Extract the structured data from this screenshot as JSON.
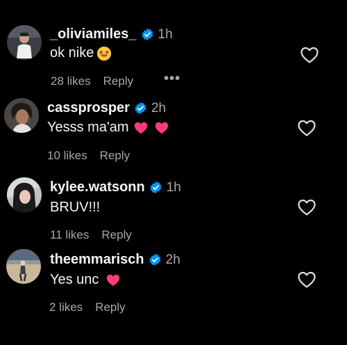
{
  "comments": [
    {
      "username": "_oliviamiles_",
      "time": "1h",
      "text": "ok nike",
      "emoji": "grinning-squinting-face",
      "likes": "28 likes",
      "reply": "Reply",
      "more": "•••"
    },
    {
      "username": "cassprosper",
      "time": "2h",
      "text": "Yesss ma'am",
      "emoji": "two-pink-hearts",
      "likes": "10 likes",
      "reply": "Reply"
    },
    {
      "username": "kylee.watsonn",
      "time": "1h",
      "text": "BRUV!!!",
      "likes": "11 likes",
      "reply": "Reply"
    },
    {
      "username": "theemmarisch",
      "time": "2h",
      "text": "Yes unc",
      "emoji": "pink-heart",
      "likes": "2 likes",
      "reply": "Reply"
    }
  ],
  "colors": {
    "background": "#000000",
    "text": "#f5f5f5",
    "secondary": "#a8a8a8",
    "verified": "#0095f6",
    "heart_emoji": "#ff3c78"
  }
}
